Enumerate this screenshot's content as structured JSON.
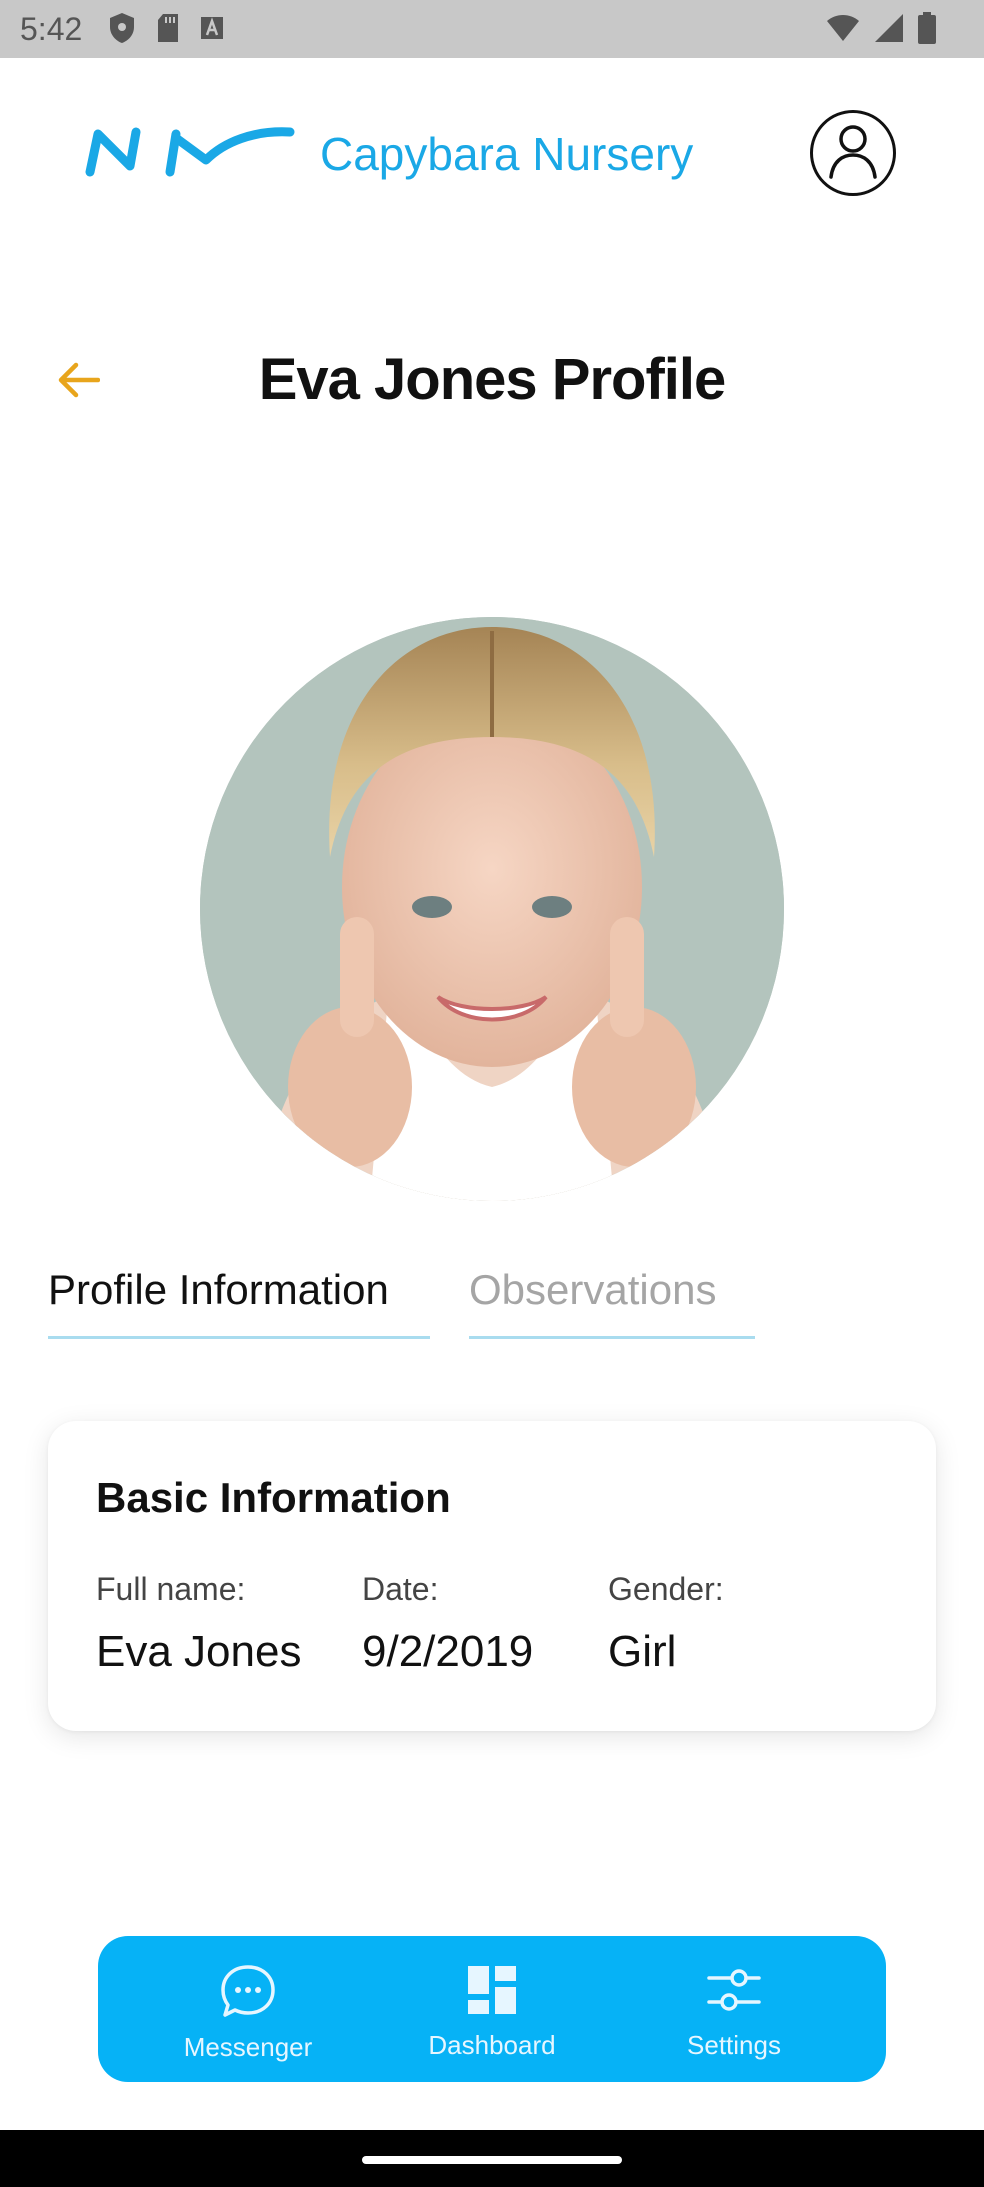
{
  "status_bar": {
    "time": "5:42",
    "left_icons": [
      "shield-icon",
      "sd-card-icon",
      "a-box-icon"
    ],
    "right_icons": [
      "wifi-icon",
      "signal-icon",
      "battery-icon"
    ]
  },
  "header": {
    "brand_name": "Capybara Nursery",
    "brand_color": "#1aa8e6"
  },
  "page": {
    "title": "Eva Jones Profile",
    "back_icon": "arrow-left-icon",
    "back_color": "#e8a51c"
  },
  "tabs": [
    {
      "label": "Profile Information",
      "active": true
    },
    {
      "label": "Observations",
      "active": false
    }
  ],
  "card": {
    "title": "Basic Information",
    "fields": [
      {
        "label": "Full name:",
        "value": "Eva Jones"
      },
      {
        "label": "Date:",
        "value": "9/2/2019"
      },
      {
        "label": "Gender:",
        "value": "Girl"
      }
    ]
  },
  "bottom_nav": {
    "background": "#06b2f6",
    "items": [
      {
        "label": "Messenger",
        "icon": "chat-bubble-icon"
      },
      {
        "label": "Dashboard",
        "icon": "dashboard-icon"
      },
      {
        "label": "Settings",
        "icon": "sliders-icon"
      }
    ]
  }
}
